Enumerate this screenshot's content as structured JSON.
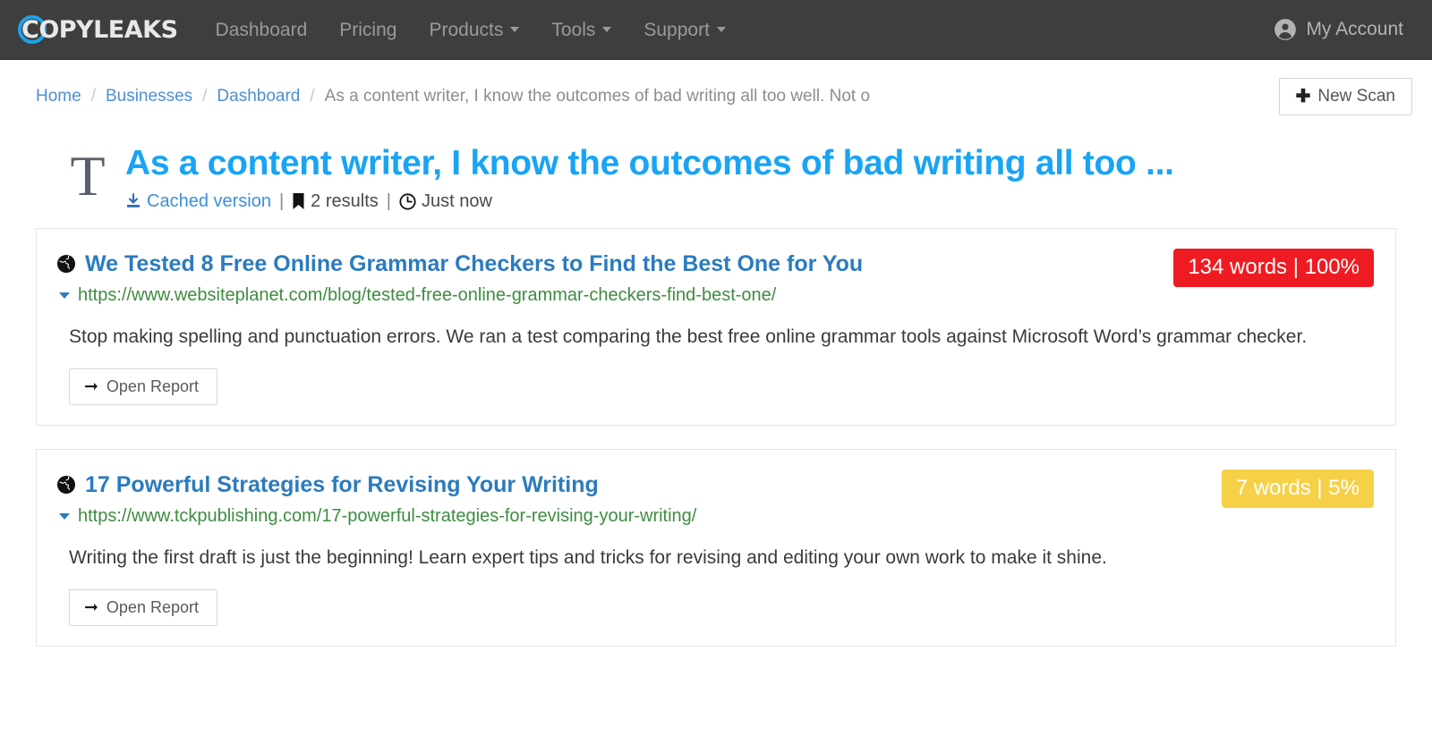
{
  "navbar": {
    "logo_text": "COPYLEAKS",
    "logo_accent_color": "#1fa1e8",
    "links": [
      {
        "label": "Dashboard",
        "caret": false
      },
      {
        "label": "Pricing",
        "caret": false
      },
      {
        "label": "Products",
        "caret": true
      },
      {
        "label": "Tools",
        "caret": true
      },
      {
        "label": "Support",
        "caret": true
      }
    ],
    "account_label": "My Account",
    "background_color": "#3e3e3e"
  },
  "breadcrumb": {
    "items": [
      {
        "label": "Home",
        "link": true
      },
      {
        "label": "Businesses",
        "link": true
      },
      {
        "label": "Dashboard",
        "link": true
      },
      {
        "label": "As a content writer, I know the outcomes of bad writing all too well. Not o",
        "link": false
      }
    ],
    "separator": "/",
    "new_scan_label": "New Scan",
    "new_scan_icon": "plus-icon"
  },
  "document": {
    "type_icon": "T",
    "title": "As a content writer, I know the outcomes of bad writing all too ...",
    "title_color": "#19a4f4",
    "meta": {
      "cached_label": "Cached version",
      "cached_icon": "download-icon",
      "results_label": "2 results",
      "results_icon": "bookmark-icon",
      "time_label": "Just now",
      "time_icon": "clock-icon",
      "separator": "|"
    }
  },
  "results": [
    {
      "source_icon": "globe-icon",
      "title": "We Tested 8 Free Online Grammar Checkers to Find the Best One for You",
      "url": "https://www.websiteplanet.com/blog/tested-free-online-grammar-checkers-find-best-one/",
      "badge_text": "134 words | 100%",
      "badge_color": "#ee1c22",
      "description": "Stop making spelling and punctuation errors. We ran a test comparing the best free online grammar tools against Microsoft Word’s grammar checker.",
      "open_report_label": "Open Report",
      "open_report_icon": "arrow-right-icon"
    },
    {
      "source_icon": "globe-icon",
      "title": "17 Powerful Strategies for Revising Your Writing",
      "url": "https://www.tckpublishing.com/17-powerful-strategies-for-revising-your-writing/",
      "badge_text": "7 words | 5%",
      "badge_color": "#f6d148",
      "description": "Writing the first draft is just the beginning! Learn expert tips and tricks for revising and editing your own work to make it shine.",
      "open_report_label": "Open Report",
      "open_report_icon": "arrow-right-icon"
    }
  ]
}
